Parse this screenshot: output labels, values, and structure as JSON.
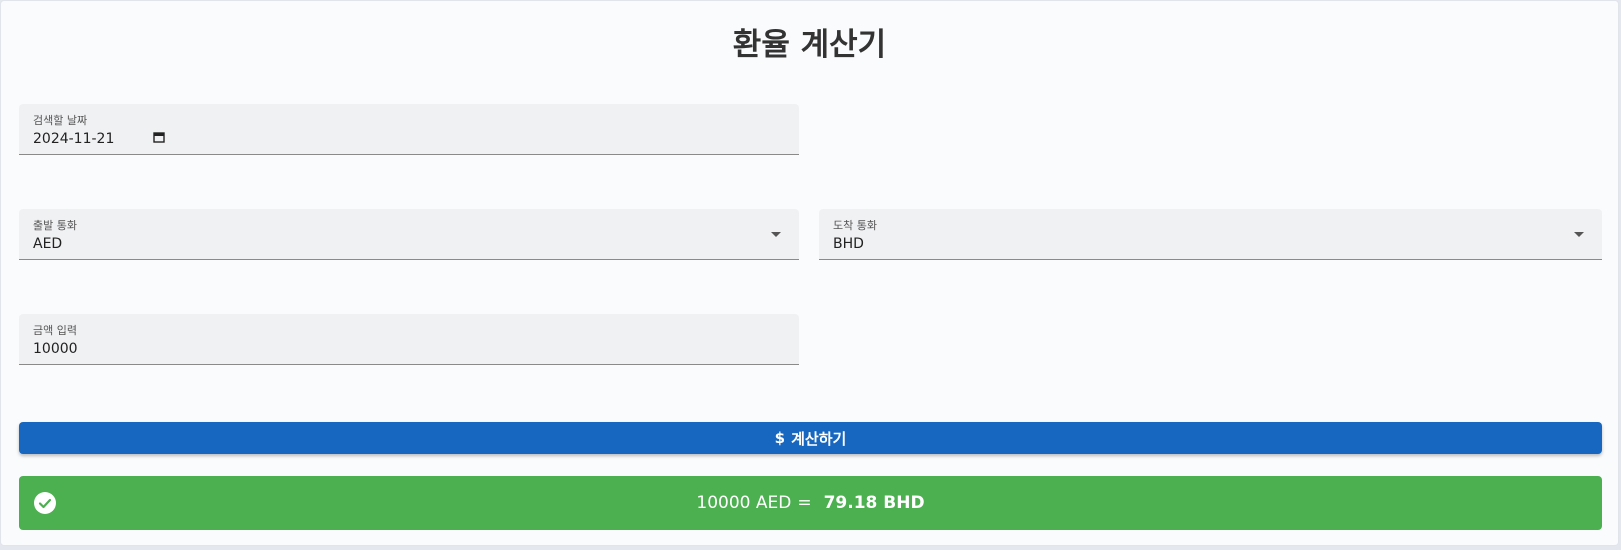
{
  "title": "환율 계산기",
  "date_field": {
    "label": "검색할 날짜",
    "value": "2024-11-21"
  },
  "from_currency": {
    "label": "출발 통화",
    "value": "AED"
  },
  "to_currency": {
    "label": "도착 통화",
    "value": "BHD"
  },
  "amount_field": {
    "label": "금액 입력",
    "value": "10000"
  },
  "calculate_button": {
    "icon": "$",
    "label": "계산하기"
  },
  "result": {
    "from_text": "10000 AED",
    "equals": "=",
    "to_text": "79.18 BHD"
  },
  "colors": {
    "button": "#1767c0",
    "result": "#4caf50"
  }
}
